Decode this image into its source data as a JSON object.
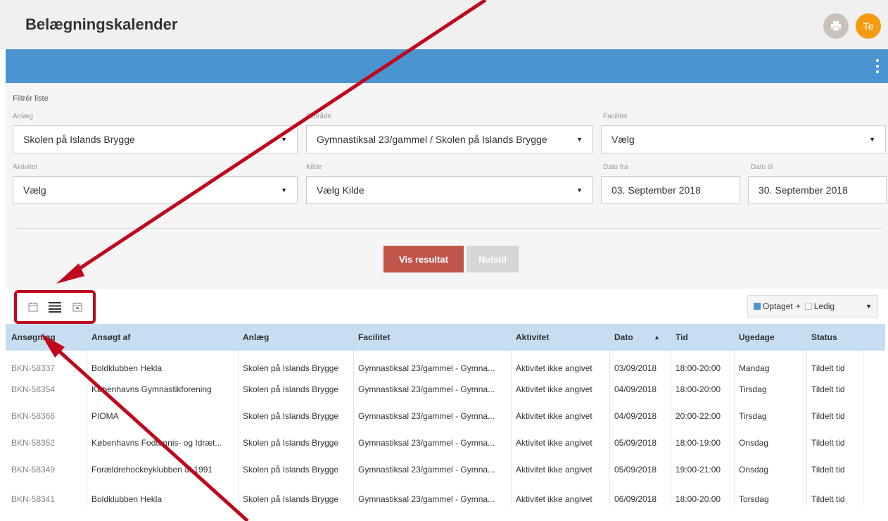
{
  "header": {
    "title": "Belægningskalender",
    "user_initials": "Te"
  },
  "filters": {
    "heading": "Filtrér liste",
    "anlaeg": {
      "label": "Anlæg",
      "value": "Skolen på Islands Brygge"
    },
    "omraade": {
      "label": "Område",
      "value": "Gymnastiksal 23/gammel / Skolen på Islands Brygge"
    },
    "facilitet": {
      "label": "Facilitet",
      "value": "Vælg"
    },
    "aktivitet": {
      "label": "Aktivitet",
      "value": "Vælg"
    },
    "kilde": {
      "label": "Kilde",
      "value": "Vælg Kilde"
    },
    "dato_fra": {
      "label": "Dato fra",
      "value": "03. September 2018"
    },
    "dato_til": {
      "label": "Dato til",
      "value": "30. September 2018"
    }
  },
  "buttons": {
    "show": "Vis resultat",
    "reset": "Nulstil"
  },
  "legend": {
    "occupied": "Optaget",
    "plus": "+",
    "free": "Ledig"
  },
  "table": {
    "columns": [
      "Ansøgning",
      "Ansøgt af",
      "Anlæg",
      "Facilitet",
      "Aktivitet",
      "Dato",
      "Tid",
      "Ugedage",
      "Status"
    ],
    "rows": [
      [
        "BKN-58337",
        "Boldklubben Hekla",
        "Skolen på Islands Brygge",
        "Gymnastiksal 23/gammel - Gymna...",
        "Aktivitet ikke angivet",
        "03/09/2018",
        "18:00-20:00",
        "Mandag",
        "Tildelt tid"
      ],
      [
        "BKN-58354",
        "Københavns Gymnastikforening",
        "Skolen på Islands Brygge",
        "Gymnastiksal 23/gammel - Gymna...",
        "Aktivitet ikke angivet",
        "04/09/2018",
        "18:00-20:00",
        "Tirsdag",
        "Tildelt tid"
      ],
      [
        "BKN-58366",
        "PIOMA",
        "Skolen på Islands Brygge",
        "Gymnastiksal 23/gammel - Gymna...",
        "Aktivitet ikke angivet",
        "04/09/2018",
        "20:00-22:00",
        "Tirsdag",
        "Tildelt tid"
      ],
      [
        "BKN-58352",
        "Københavns Fodtennis- og Idræt...",
        "Skolen på Islands Brygge",
        "Gymnastiksal 23/gammel - Gymna...",
        "Aktivitet ikke angivet",
        "05/09/2018",
        "18:00-19:00",
        "Onsdag",
        "Tildelt tid"
      ],
      [
        "BKN-58349",
        "Forældrehockeyklubben af 1991",
        "Skolen på Islands Brygge",
        "Gymnastiksal 23/gammel - Gymna...",
        "Aktivitet ikke angivet",
        "05/09/2018",
        "19:00-21:00",
        "Onsdag",
        "Tildelt tid"
      ],
      [
        "BKN-58341",
        "Boldklubben Hekla",
        "Skolen på Islands Brygge",
        "Gymnastiksal 23/gammel - Gymna...",
        "Aktivitet ikke angivet",
        "06/09/2018",
        "18:00-20:00",
        "Torsdag",
        "Tildelt tid"
      ]
    ]
  },
  "colors": {
    "accent_blue": "#4a95d1",
    "header_row": "#c7ddf0",
    "show_button": "#c1554a",
    "avatar": "#f39c12",
    "annotation": "#c0071d"
  }
}
